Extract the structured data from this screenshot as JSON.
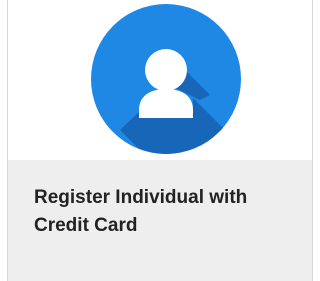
{
  "card": {
    "title": "Register Individual with Credit Card",
    "icon": "user-avatar-icon",
    "colors": {
      "circle": "#1f88e5",
      "shadow": "#1760b0",
      "figure": "#ffffff",
      "footer_bg": "#eeeeee",
      "title_text": "#222222"
    }
  }
}
